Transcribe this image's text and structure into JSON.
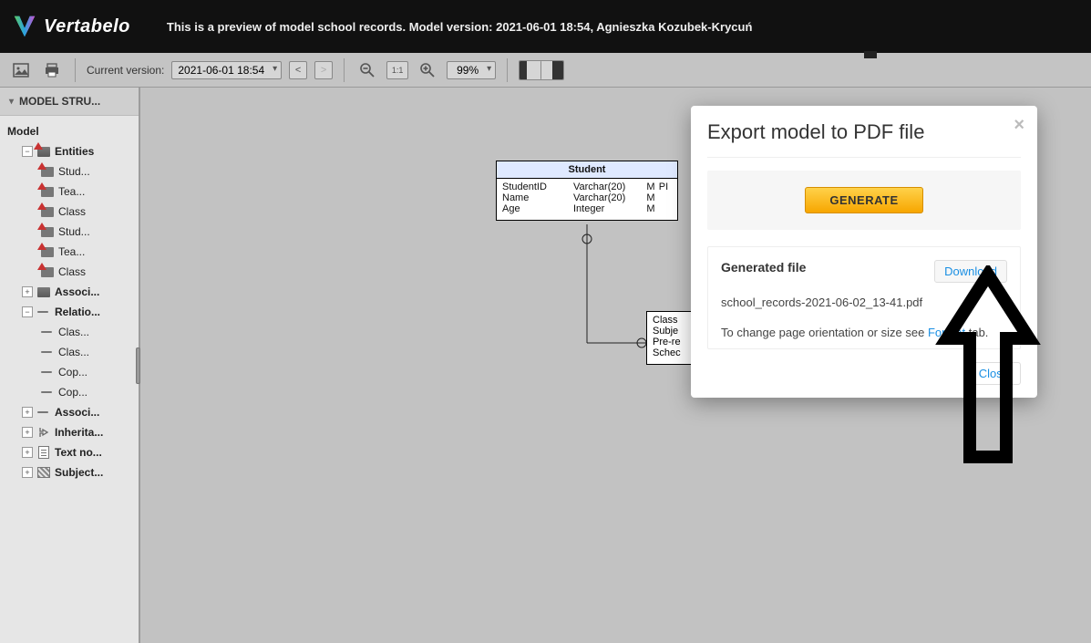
{
  "header": {
    "logo_text": "Vertabelo",
    "preview_text": "This is a preview of model school records. Model version: 2021-06-01 18:54, Agnieszka Kozubek-Krycuń"
  },
  "toolbar": {
    "current_version_label": "Current version:",
    "current_version_value": "2021-06-01 18:54",
    "prev_label": "<",
    "next_label": ">",
    "zoom_ratio_label": "1:1",
    "zoom_value": "99%"
  },
  "sidebar": {
    "header": "MODEL STRU...",
    "model_label": "Model",
    "entities_label": "Entities",
    "entities": [
      "Stud...",
      "Tea...",
      "Class",
      "Stud...",
      "Tea...",
      "Class"
    ],
    "associ_label": "Associ...",
    "relatio_label": "Relatio...",
    "relations": [
      "Clas...",
      "Clas...",
      "Cop...",
      "Cop..."
    ],
    "associ2_label": "Associ...",
    "inherita_label": "Inherita...",
    "textno_label": "Text no...",
    "subject_label": "Subject..."
  },
  "er": {
    "student_title": "Student",
    "student_rows": [
      {
        "name": "StudentID",
        "type": "Varchar(20)",
        "m": "M",
        "pi": "PI"
      },
      {
        "name": "Name",
        "type": "Varchar(20)",
        "m": "M",
        "pi": ""
      },
      {
        "name": "Age",
        "type": "Integer",
        "m": "M",
        "pi": ""
      }
    ],
    "class_rows": [
      "Class",
      "Subje",
      "Pre-re",
      "Schec"
    ]
  },
  "modal": {
    "title": "Export model to PDF file",
    "generate_btn": "GENERATE",
    "gen_file_label": "Generated file",
    "download_btn": "Download",
    "filename": "school_records-2021-06-02_13-41.pdf",
    "orient_prefix": "To change page orientation or size see ",
    "orient_link": "Format",
    "orient_suffix": " tab.",
    "close_btn": "Close"
  }
}
